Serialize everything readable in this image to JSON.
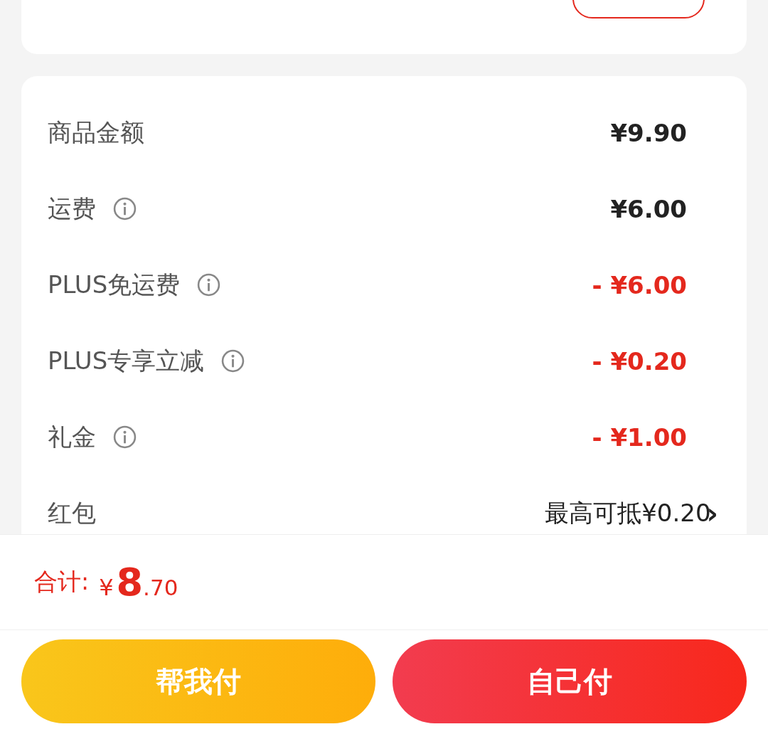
{
  "summary": {
    "rows": [
      {
        "label": "商品金额",
        "info": false,
        "kind": "amount",
        "value": "¥9.90"
      },
      {
        "label": "运费",
        "info": true,
        "kind": "amount",
        "value": "¥6.00"
      },
      {
        "label": "PLUS免运费",
        "info": true,
        "kind": "discount",
        "value": "- ¥6.00"
      },
      {
        "label": "PLUS专享立减",
        "info": true,
        "kind": "discount",
        "value": "- ¥0.20"
      },
      {
        "label": "礼金",
        "info": true,
        "kind": "discount",
        "value": "- ¥1.00"
      },
      {
        "label": "红包",
        "info": false,
        "kind": "link",
        "value": "最高可抵¥0.20",
        "arrow": "›"
      }
    ]
  },
  "total": {
    "label": "合计:",
    "currency": "¥",
    "integer": "8",
    "decimal": ".70"
  },
  "buttons": [
    {
      "label": "帮我付",
      "kind": "secondary"
    },
    {
      "label": "自己付",
      "kind": "primary"
    }
  ]
}
